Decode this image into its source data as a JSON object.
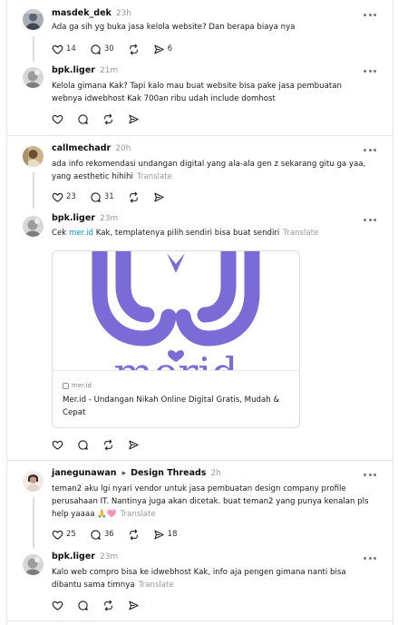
{
  "icons": {
    "like": "heart-icon",
    "reply": "comment-icon",
    "repost": "repost-icon",
    "share": "send-icon",
    "more": "more-icon"
  },
  "colors": {
    "link": "#0095f6",
    "muted": "#999999",
    "brand": "#7b6bd6"
  },
  "posts": [
    {
      "username": "masdek_dek",
      "time": "23h",
      "text": "Ada ga sih yg buka jasa kelola website? Dan berapa biaya nya",
      "likes": "14",
      "replies": "30",
      "shares": "6"
    },
    {
      "username": "bpk.liger",
      "time": "21m",
      "text": "Kelola gimana Kak? Tapi kalo mau buat website bisa pake jasa pembuatan webnya idwebhost Kak 700an ribu udah include domhost"
    },
    {
      "username": "callmechadr",
      "time": "20h",
      "text": "ada info rekomendasi undangan digital yang ala-ala gen z sekarang gitu ga yaa, yang aesthetic hihihi",
      "translate": "Translate",
      "likes": "23",
      "replies": "31"
    },
    {
      "username": "bpk.liger",
      "time": "23m",
      "text_before": "Cek ",
      "link": "mer.id",
      "text_after": " Kak, templatenya pilih sendiri bisa buat sendiri",
      "translate": "Translate",
      "card": {
        "image_text": "merid",
        "domain": "mer.id",
        "title": "Mer.id - Undangan Nikah Online Digital Gratis, Mudah & Cepat"
      }
    },
    {
      "username": "janegunawan",
      "separator": "▸",
      "community": "Design Threads",
      "time": "2h",
      "text": "teman2 aku lgi nyari vendor untuk jasa pembuatan design company profile perusahaan IT. Nantinya juga akan dicetak. buat teman2 yang punya kenalan pls help yaaaa 🙏🩷",
      "translate": "Translate",
      "likes": "25",
      "replies": "36",
      "shares": "18"
    },
    {
      "username": "bpk.liger",
      "time": "23m",
      "text": "Kalo web compro bisa ke idwebhost Kak, info aja pengen gimana nanti bisa dibantu sama timnya",
      "translate": "Translate"
    }
  ]
}
